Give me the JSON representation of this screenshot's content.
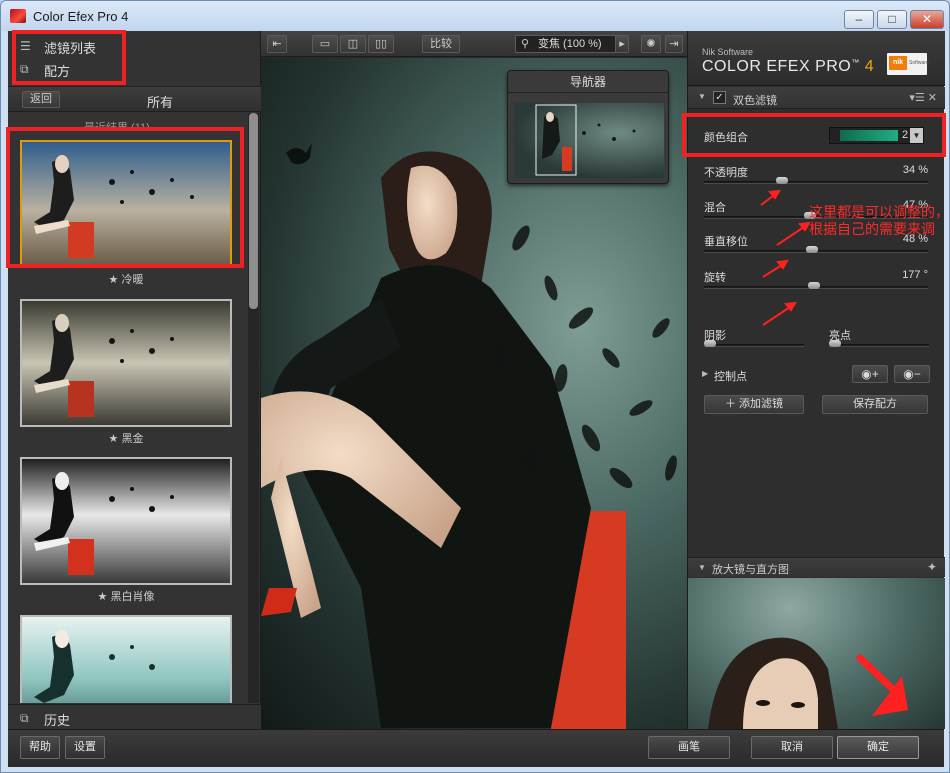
{
  "window": {
    "title": "Color Efex Pro 4",
    "min": "–",
    "max": "□",
    "close": "✕"
  },
  "left": {
    "filter_list": "滤镜列表",
    "recipes": "配方",
    "back": "返回",
    "category": "所有",
    "list_head": "最近结果 (11)",
    "presets": [
      {
        "label": "★ 冷暖"
      },
      {
        "label": "★ 黑金"
      },
      {
        "label": "★ 黑白肖像"
      },
      {
        "label": ""
      }
    ],
    "history": "历史"
  },
  "toolbar": {
    "compare": "比较",
    "zoom": "变焦 (100 %)"
  },
  "navigator": {
    "title": "导航器"
  },
  "right": {
    "nik": "Nik Software",
    "product": "COLOR EFEX PRO",
    "tm": "™",
    "version": "4",
    "logo_text": "nik",
    "logo_sub": "Software",
    "filter_name": "双色滤镜",
    "color_set_label": "颜色组合",
    "color_set_value": "2",
    "params": [
      {
        "label": "不透明度",
        "value": "34 %",
        "level": 0.34
      },
      {
        "label": "混合",
        "value": "47 %",
        "level": 0.47
      },
      {
        "label": "垂直移位",
        "value": "48 %",
        "level": 0.48
      },
      {
        "label": "旋转",
        "value": "177 °",
        "level": 0.49
      }
    ],
    "shadow_label": "阴影",
    "highlight_label": "亮点",
    "control_points": "控制点",
    "add_filter": "＋ 添加滤镜",
    "save_recipe": "保存配方",
    "loupe": "放大镜与直方图"
  },
  "annotation": "这里都是可以调整的，根据自己的需要来调",
  "bottom": {
    "help": "帮助",
    "settings": "设置",
    "brush": "画笔",
    "cancel": "取消",
    "ok": "确定"
  },
  "colors": {
    "accent_red": "#ee2222",
    "selected_orange": "#e09a0d",
    "teal": "#1fae83"
  }
}
